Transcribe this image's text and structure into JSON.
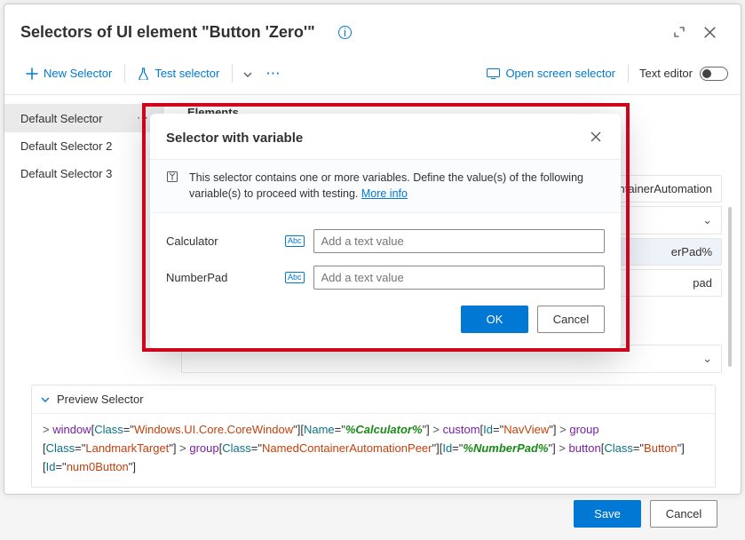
{
  "header": {
    "title": "Selectors of UI element \"Button 'Zero'\""
  },
  "toolbar": {
    "new_selector": "New Selector",
    "test_selector": "Test selector",
    "open_screen": "Open screen selector",
    "text_editor": "Text editor"
  },
  "sidebar": {
    "items": [
      {
        "label": "Default Selector",
        "selected": true
      },
      {
        "label": "Default Selector 2",
        "selected": false
      },
      {
        "label": "Default Selector 3",
        "selected": false
      }
    ]
  },
  "elements": {
    "heading": "Elements",
    "rows": [
      {
        "name": "containerAutomation"
      },
      {
        "name": "erPad%"
      },
      {
        "name": "pad"
      }
    ]
  },
  "dialog": {
    "title": "Selector with variable",
    "info_text": "This selector contains one or more variables. Define the value(s) of the following variable(s) to proceed with testing. ",
    "more_info": "More info",
    "fields": [
      {
        "label": "Calculator",
        "placeholder": "Add a text value"
      },
      {
        "label": "NumberPad",
        "placeholder": "Add a text value"
      }
    ],
    "ok": "OK",
    "cancel": "Cancel"
  },
  "preview": {
    "title": "Preview Selector",
    "segments": [
      {
        "t": "gt",
        "v": "> "
      },
      {
        "t": "tag",
        "v": "window"
      },
      {
        "t": "plain",
        "v": "["
      },
      {
        "t": "attr",
        "v": "Class"
      },
      {
        "t": "plain",
        "v": "=\""
      },
      {
        "t": "lit",
        "v": "Windows.UI.Core.CoreWindow"
      },
      {
        "t": "plain",
        "v": "\"]["
      },
      {
        "t": "attr",
        "v": "Name"
      },
      {
        "t": "plain",
        "v": "=\""
      },
      {
        "t": "var",
        "v": "%Calculator%"
      },
      {
        "t": "plain",
        "v": "\"]"
      },
      {
        "t": "gt",
        "v": " > "
      },
      {
        "t": "tag",
        "v": "custom"
      },
      {
        "t": "plain",
        "v": "["
      },
      {
        "t": "attr",
        "v": "Id"
      },
      {
        "t": "plain",
        "v": "=\""
      },
      {
        "t": "lit",
        "v": "NavView"
      },
      {
        "t": "plain",
        "v": "\"]"
      },
      {
        "t": "gt",
        "v": " > "
      },
      {
        "t": "tag",
        "v": "group"
      },
      {
        "t": "plain",
        "v": " ["
      },
      {
        "t": "attr",
        "v": "Class"
      },
      {
        "t": "plain",
        "v": "=\""
      },
      {
        "t": "lit",
        "v": "LandmarkTarget"
      },
      {
        "t": "plain",
        "v": "\"]"
      },
      {
        "t": "gt",
        "v": " > "
      },
      {
        "t": "tag",
        "v": "group"
      },
      {
        "t": "plain",
        "v": "["
      },
      {
        "t": "attr",
        "v": "Class"
      },
      {
        "t": "plain",
        "v": "=\""
      },
      {
        "t": "lit",
        "v": "NamedContainerAutomationPeer"
      },
      {
        "t": "plain",
        "v": "\"]["
      },
      {
        "t": "attr",
        "v": "Id"
      },
      {
        "t": "plain",
        "v": "=\""
      },
      {
        "t": "var",
        "v": "%NumberPad%"
      },
      {
        "t": "plain",
        "v": "\"]"
      },
      {
        "t": "gt",
        "v": " > "
      },
      {
        "t": "tag",
        "v": "button"
      },
      {
        "t": "plain",
        "v": "["
      },
      {
        "t": "attr",
        "v": "Class"
      },
      {
        "t": "plain",
        "v": "=\""
      },
      {
        "t": "lit",
        "v": "Button"
      },
      {
        "t": "plain",
        "v": "\"] ["
      },
      {
        "t": "attr",
        "v": "Id"
      },
      {
        "t": "plain",
        "v": "=\""
      },
      {
        "t": "lit",
        "v": "num0Button"
      },
      {
        "t": "plain",
        "v": "\"]"
      }
    ]
  },
  "footer": {
    "save": "Save",
    "cancel": "Cancel"
  }
}
